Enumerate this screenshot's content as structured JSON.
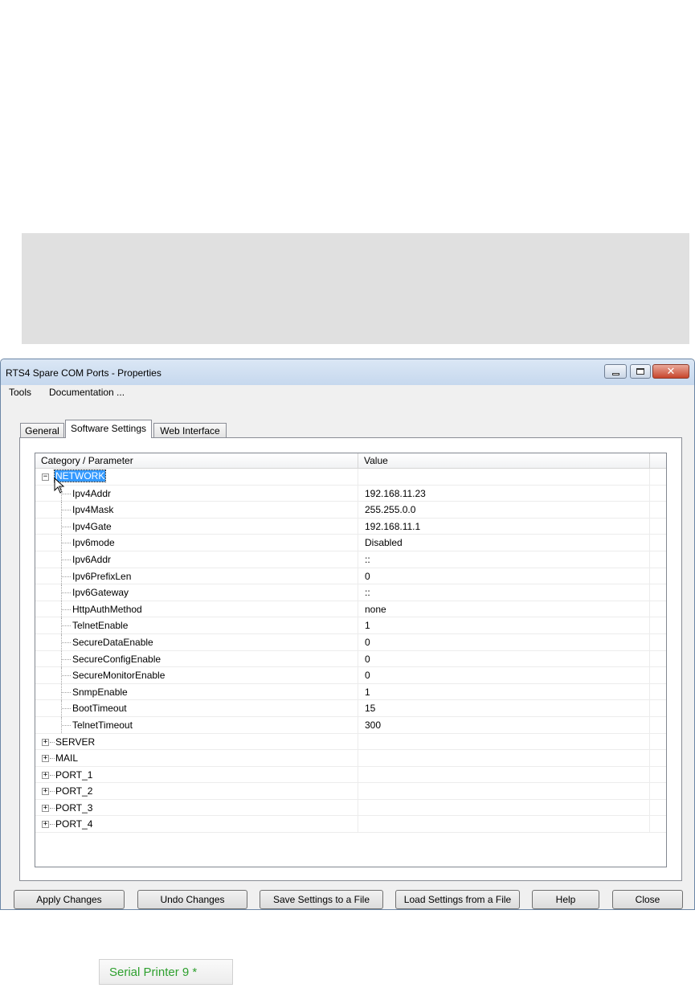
{
  "doc_links": {
    "link_a": "",
    "link_b": "",
    "link_c": "",
    "link_d": ""
  },
  "window": {
    "title": "RTS4 Spare COM Ports - Properties",
    "menu": [
      "Tools",
      "Documentation ..."
    ]
  },
  "tabs": [
    "General",
    "Software Settings",
    "Web Interface"
  ],
  "active_tab": "Software Settings",
  "table": {
    "headers": [
      "Category / Parameter",
      "Value"
    ],
    "expanded_group": "NETWORK",
    "params": [
      {
        "name": "Ipv4Addr",
        "value": "192.168.11.23"
      },
      {
        "name": "Ipv4Mask",
        "value": "255.255.0.0"
      },
      {
        "name": "Ipv4Gate",
        "value": "192.168.11.1"
      },
      {
        "name": "Ipv6mode",
        "value": "Disabled"
      },
      {
        "name": "Ipv6Addr",
        "value": "::"
      },
      {
        "name": "Ipv6PrefixLen",
        "value": "0"
      },
      {
        "name": "Ipv6Gateway",
        "value": "::"
      },
      {
        "name": "HttpAuthMethod",
        "value": "none"
      },
      {
        "name": "TelnetEnable",
        "value": "1"
      },
      {
        "name": "SecureDataEnable",
        "value": "0"
      },
      {
        "name": "SecureConfigEnable",
        "value": "0"
      },
      {
        "name": "SecureMonitorEnable",
        "value": "0"
      },
      {
        "name": "SnmpEnable",
        "value": "1"
      },
      {
        "name": "BootTimeout",
        "value": "15"
      },
      {
        "name": "TelnetTimeout",
        "value": "300"
      }
    ],
    "collapsed_groups": [
      "SERVER",
      "MAIL",
      "PORT_1",
      "PORT_2",
      "PORT_3",
      "PORT_4"
    ]
  },
  "buttons": {
    "apply": "Apply Changes",
    "undo": "Undo Changes",
    "save": "Save Settings to a File",
    "load": "Load Settings from a File",
    "help": "Help",
    "close": "Close"
  },
  "footer_tab": "Serial Printer 9 *",
  "icons": {
    "minimize": "minimize-icon",
    "maximize": "maximize-icon",
    "close": "close-icon",
    "expand": "plus-box-icon",
    "collapse": "minus-box-icon",
    "cursor": "mouse-pointer-icon"
  }
}
